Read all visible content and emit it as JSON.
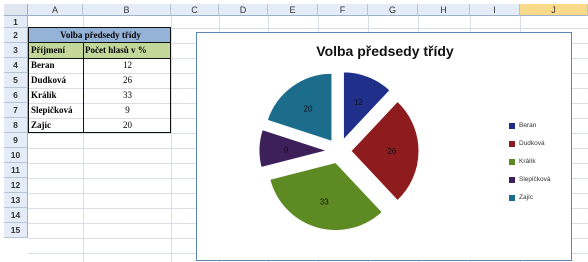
{
  "columns": [
    "A",
    "B",
    "C",
    "D",
    "E",
    "F",
    "G",
    "H",
    "I",
    "J"
  ],
  "selected_column": "J",
  "rows": [
    "1",
    "2",
    "3",
    "4",
    "5",
    "6",
    "7",
    "8",
    "9",
    "10",
    "11",
    "12",
    "13",
    "14",
    "15"
  ],
  "table": {
    "title": "Volba předsedy třídy",
    "headers": [
      "Příjmení",
      "Počet hlasů v %"
    ],
    "rows": [
      [
        "Beran",
        "12"
      ],
      [
        "Dudková",
        "26"
      ],
      [
        "Králík",
        "33"
      ],
      [
        "Slepičková",
        "9"
      ],
      [
        "Zajíc",
        "20"
      ]
    ]
  },
  "chart_data": {
    "type": "pie",
    "title": "Volba předsedy třídy",
    "categories": [
      "Beran",
      "Dudková",
      "Králík",
      "Slepičková",
      "Zajíc"
    ],
    "values": [
      12,
      26,
      33,
      9,
      20
    ],
    "colors": [
      "#1f2f8a",
      "#8e1b1d",
      "#5e8a23",
      "#3d1f5a",
      "#1c6c8c"
    ],
    "exploded": true,
    "data_labels": true,
    "legend_position": "right"
  }
}
